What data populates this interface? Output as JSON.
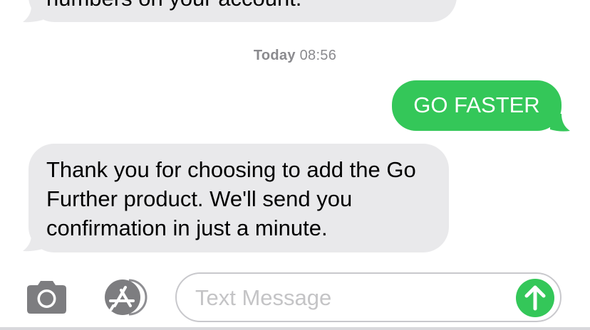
{
  "conversation": {
    "previous_message_text": "numbers on your account.",
    "timestamp": {
      "day": "Today",
      "time": "08:56"
    },
    "messages": [
      {
        "direction": "outgoing",
        "text": "GO FASTER"
      },
      {
        "direction": "incoming",
        "text": "Thank you for choosing to add the Go Further product. We'll send you confirmation in just a minute."
      }
    ]
  },
  "input_bar": {
    "placeholder": "Text Message",
    "icons": [
      "camera-icon",
      "app-store-icon",
      "send-arrow-icon"
    ]
  },
  "colors": {
    "incoming_bubble": "#e9e9eb",
    "outgoing_bubble": "#34c759",
    "send_button": "#34c759",
    "timestamp_text": "#8a8a8e",
    "icon_gray": "#7d7d80"
  }
}
